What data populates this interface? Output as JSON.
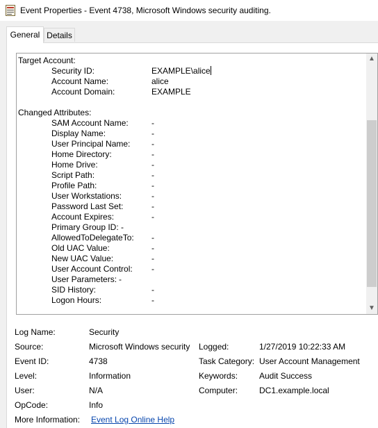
{
  "window": {
    "title": "Event Properties - Event 4738, Microsoft Windows security auditing.",
    "app_icon": "event-viewer-icon"
  },
  "tabs": [
    {
      "label": "General",
      "active": true
    },
    {
      "label": "Details",
      "active": false
    }
  ],
  "description": {
    "target_account_header": "Target Account:",
    "target_account": [
      {
        "label": "Security ID:",
        "value": "EXAMPLE\\alice"
      },
      {
        "label": "Account Name:",
        "value": "alice"
      },
      {
        "label": "Account Domain:",
        "value": "EXAMPLE"
      }
    ],
    "changed_attributes_header": "Changed Attributes:",
    "changed_attributes": [
      {
        "label": "SAM Account Name:",
        "value": "-"
      },
      {
        "label": "Display Name:",
        "value": "-"
      },
      {
        "label": "User Principal Name:",
        "value": "-"
      },
      {
        "label": "Home Directory:",
        "value": "-"
      },
      {
        "label": "Home Drive:",
        "value": "-"
      },
      {
        "label": "Script Path:",
        "value": "-"
      },
      {
        "label": "Profile Path:",
        "value": "-"
      },
      {
        "label": "User Workstations:",
        "value": "-"
      },
      {
        "label": "Password Last Set:",
        "value": "-"
      },
      {
        "label": "Account Expires:",
        "value": "-"
      },
      {
        "label": "Primary Group ID: -",
        "value": ""
      },
      {
        "label": "AllowedToDelegateTo:",
        "value": "-"
      },
      {
        "label": "Old UAC Value:",
        "value": "-"
      },
      {
        "label": "New UAC Value:",
        "value": "-"
      },
      {
        "label": "User Account Control:",
        "value": "-"
      },
      {
        "label": "User Parameters:",
        "value": "-"
      },
      {
        "label": "SID History:",
        "value": "-"
      },
      {
        "label": "Logon Hours:",
        "value": "-"
      }
    ]
  },
  "details": {
    "log_name_label": "Log Name:",
    "log_name": "Security",
    "source_label": "Source:",
    "source": "Microsoft Windows security",
    "logged_label": "Logged:",
    "logged": "1/27/2019 10:22:33 AM",
    "event_id_label": "Event ID:",
    "event_id": "4738",
    "task_category_label": "Task Category:",
    "task_category": "User Account Management",
    "level_label": "Level:",
    "level": "Information",
    "keywords_label": "Keywords:",
    "keywords": "Audit Success",
    "user_label": "User:",
    "user": "N/A",
    "computer_label": "Computer:",
    "computer": "DC1.example.local",
    "opcode_label": "OpCode:",
    "opcode": "Info",
    "more_info_label": "More Information:",
    "more_info_link": "Event Log Online Help"
  },
  "colors": {
    "link": "#0645ad",
    "background": "#f0f0f0",
    "panel": "#ffffff"
  }
}
